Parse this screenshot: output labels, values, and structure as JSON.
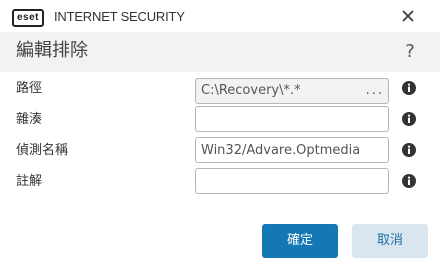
{
  "window": {
    "brand_logo": "eset",
    "product": "INTERNET SECURITY",
    "close_icon": "close-icon"
  },
  "dialog": {
    "title": "編輯排除",
    "help": "?"
  },
  "form": {
    "path": {
      "label": "路徑",
      "value": "C:\\Recovery\\*.*",
      "browse": "..."
    },
    "hash": {
      "label": "雜湊",
      "value": ""
    },
    "detection_name": {
      "label": "偵測名稱",
      "value": "Win32/Advare.Optmedia"
    },
    "comment": {
      "label": "註解",
      "value": ""
    },
    "info_icon": "info-icon"
  },
  "buttons": {
    "ok": "確定",
    "cancel": "取消"
  },
  "colors": {
    "primary": "#1378b5",
    "secondary_bg": "#d9e6ef",
    "header_bg": "#f2f2f2"
  }
}
